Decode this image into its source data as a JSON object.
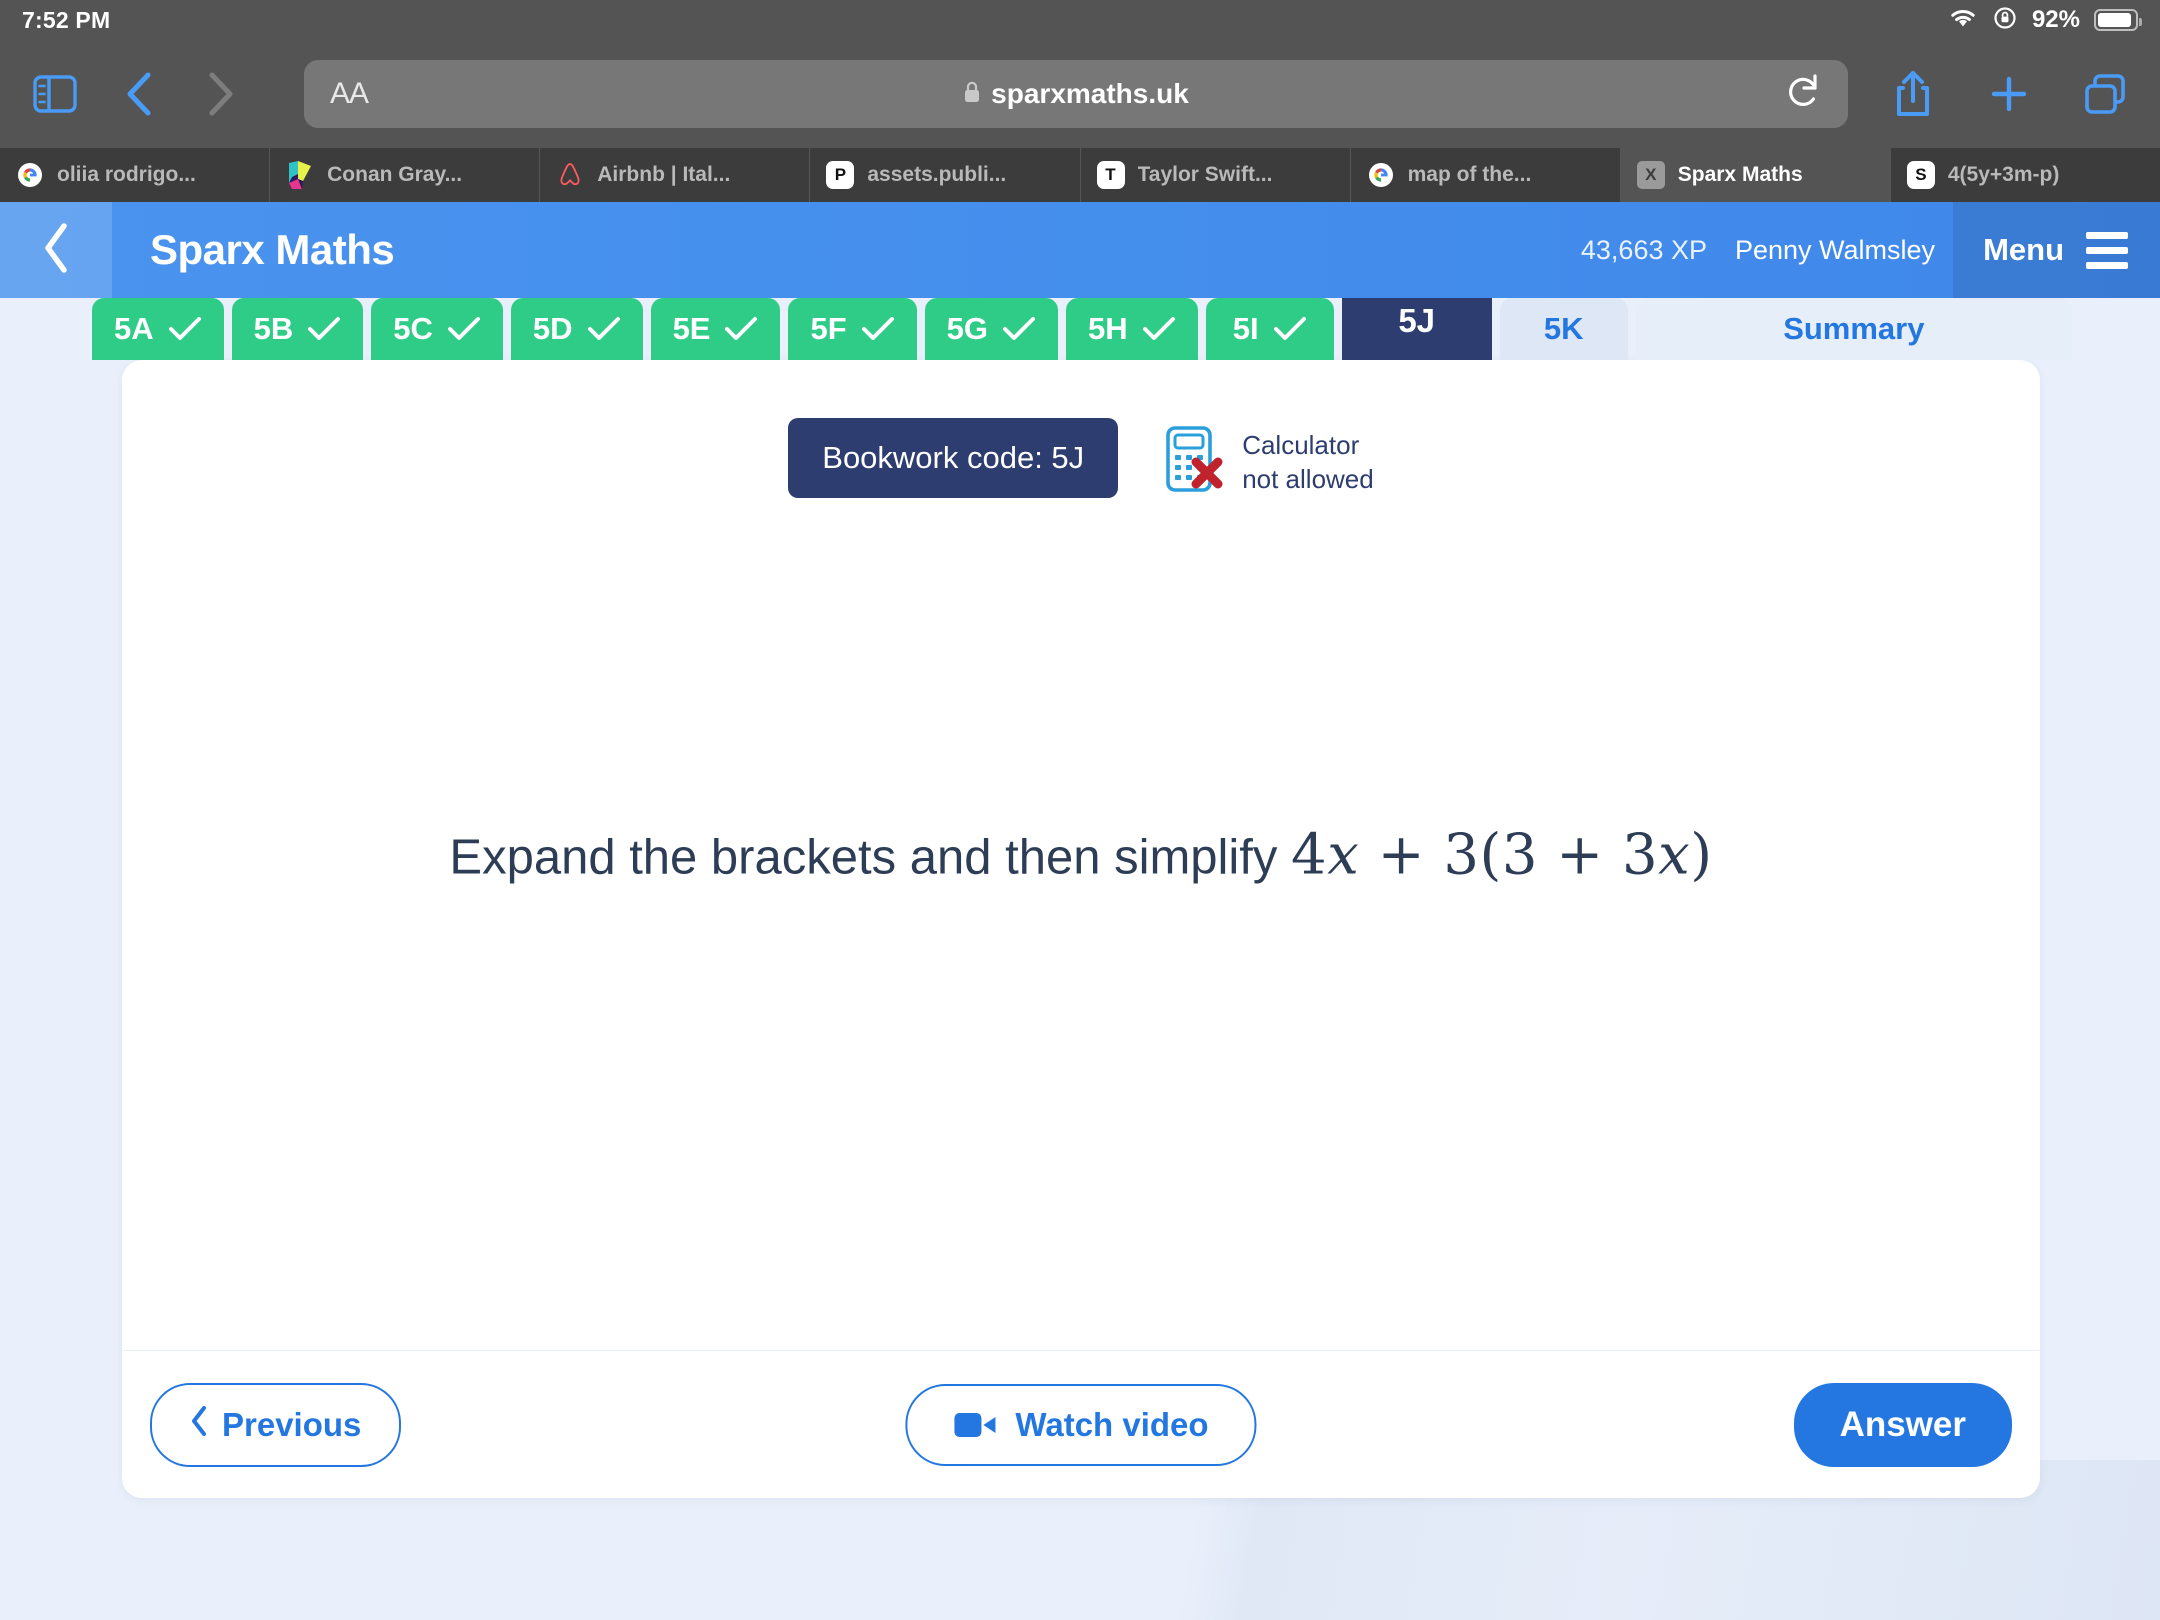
{
  "status_bar": {
    "time": "7:52 PM",
    "wifi_icon": "wifi-icon",
    "rotation_lock_icon": "rotation-lock-icon",
    "battery_percent": "92%",
    "battery_level": 92
  },
  "browser_toolbar": {
    "sidebar_icon": "sidebar-icon",
    "back_icon": "chevron-left-icon",
    "forward_icon": "chevron-right-icon",
    "text_size_label": "AA",
    "lock_icon": "lock-icon",
    "url": "sparxmaths.uk",
    "reload_icon": "reload-icon",
    "share_icon": "share-icon",
    "new_tab_icon": "plus-icon",
    "tab_overview_icon": "tabs-icon"
  },
  "browser_tabs": [
    {
      "title": "oliia rodrigo...",
      "favicon": "google-icon",
      "active": false
    },
    {
      "title": "Conan Gray...",
      "favicon": "colorful-icon",
      "active": false
    },
    {
      "title": "Airbnb | Ital...",
      "favicon": "airbnb-icon",
      "active": false
    },
    {
      "title": "assets.publi...",
      "favicon": "letter-P",
      "active": false
    },
    {
      "title": "Taylor Swift...",
      "favicon": "letter-T",
      "active": false
    },
    {
      "title": "map of the...",
      "favicon": "google-icon",
      "active": false
    },
    {
      "title": "Sparx Maths",
      "favicon": "letter-X",
      "active": true
    },
    {
      "title": "4(5y+3m-p)",
      "favicon": "letter-S",
      "active": false
    }
  ],
  "app_header": {
    "back_icon": "chevron-left-icon",
    "brand": "Sparx Maths",
    "xp": "43,663 XP",
    "user_name": "Penny Walmsley",
    "menu_label": "Menu",
    "menu_icon": "hamburger-icon",
    "accent_blue": "#3f88ea"
  },
  "task_tabs": [
    {
      "label": "5A",
      "state": "done"
    },
    {
      "label": "5B",
      "state": "done"
    },
    {
      "label": "5C",
      "state": "done"
    },
    {
      "label": "5D",
      "state": "done"
    },
    {
      "label": "5E",
      "state": "done"
    },
    {
      "label": "5F",
      "state": "done"
    },
    {
      "label": "5G",
      "state": "done"
    },
    {
      "label": "5H",
      "state": "done"
    },
    {
      "label": "5I",
      "state": "done"
    },
    {
      "label": "5J",
      "state": "current"
    },
    {
      "label": "5K",
      "state": "todo"
    },
    {
      "label": "Summary",
      "state": "summary"
    }
  ],
  "question_card": {
    "bookwork_code": "Bookwork code: 5J",
    "calculator_icon": "calculator-not-allowed-icon",
    "calculator_line1": "Calculator",
    "calculator_line2": "not allowed",
    "prompt": "Expand the brackets and then simplify",
    "expression": "4x + 3(3 + 3x)",
    "expression_parts": {
      "term1_coeff": "4",
      "term1_var": "x",
      "op1": "+",
      "term2_coeff": "3",
      "open": "(",
      "inner1": "3",
      "op2": "+",
      "inner2_coeff": "3",
      "inner2_var": "x",
      "close": ")"
    }
  },
  "footer": {
    "previous_label": "Previous",
    "previous_icon": "chevron-left-icon",
    "watch_video_label": "Watch video",
    "watch_video_icon": "video-camera-icon",
    "answer_label": "Answer"
  },
  "colors": {
    "green_done": "#2ecc87",
    "navy_current": "#2e3d70",
    "blue_accent": "#2477e0",
    "page_bg": "#eaf0fb"
  }
}
